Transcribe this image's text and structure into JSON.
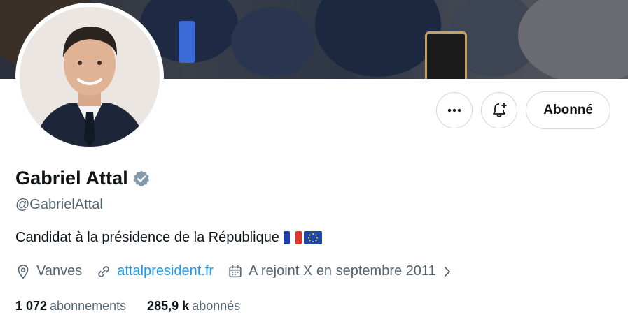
{
  "profile": {
    "name": "Gabriel Attal",
    "handle": "@GabrielAttal",
    "bio": "Candidat à la présidence de la République",
    "bio_emojis": [
      "french-flag",
      "eu-flag"
    ],
    "location": "Vanves",
    "website": "attalpresident.fr",
    "joined": "A rejoint X en septembre 2011",
    "verified": true
  },
  "actions": {
    "more_icon": "more-horizontal-icon",
    "notify_icon": "bell-plus-icon",
    "follow_label": "Abonné"
  },
  "stats": {
    "following_count": "1 072",
    "following_label": "abonnements",
    "followers_count": "285,9 k",
    "followers_label": "abonnés"
  },
  "colors": {
    "accent": "#1d9bf0",
    "secondary_text": "#536471",
    "primary_text": "#0f1419",
    "border": "#cfd9de",
    "verified_badge": "#829aab"
  }
}
